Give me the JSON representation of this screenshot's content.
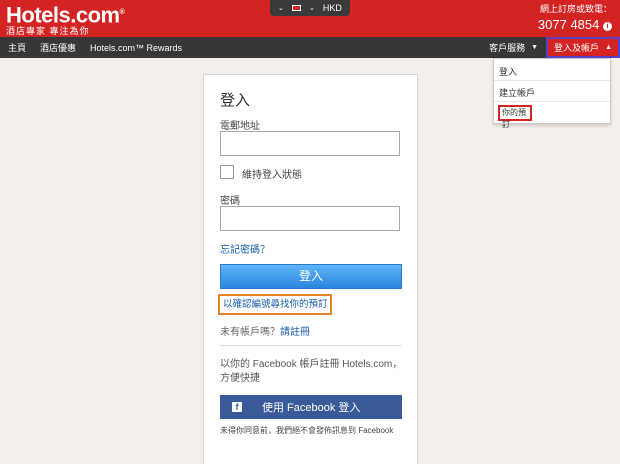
{
  "header": {
    "logo_main": "Hotels.com",
    "logo_tm": "®",
    "logo_tagline": "酒店專家 專注為你",
    "currency": "HKD",
    "phone_label": "網上訂房或致電：",
    "phone_number": "3077 4854",
    "info_glyph": "i",
    "brand_color": "#d32323"
  },
  "nav": {
    "items": [
      {
        "label": "主頁"
      },
      {
        "label": "酒店優惠"
      },
      {
        "label": "Hotels.com™ Rewards"
      }
    ],
    "customer_service": "客戶服務",
    "account": "登入及帳戶"
  },
  "dropdown": {
    "login": "登入",
    "create_account": "建立帳戶",
    "my_bookings": "你的預訂"
  },
  "login": {
    "title": "登入",
    "email_label": "電郵地址",
    "email_value": "",
    "remember_label": "維持登入狀態",
    "password_label": "密碼",
    "password_value": "",
    "forgot": "忘記密碼？",
    "submit": "登入",
    "find_booking": "以確認編號尋找你的預訂",
    "no_account": "未有帳戶嗎？",
    "register": "請註冊",
    "facebook_text": "以你的 Facebook 帳戶註冊 Hotels.com，方便快捷",
    "facebook_button": "使用 Facebook 登入",
    "facebook_icon": "f",
    "facebook_note": "未得你同意前，我們絕不會發佈訊息到 Facebook",
    "facebook_color": "#3b5a9a",
    "button_color": "#2b85df"
  }
}
